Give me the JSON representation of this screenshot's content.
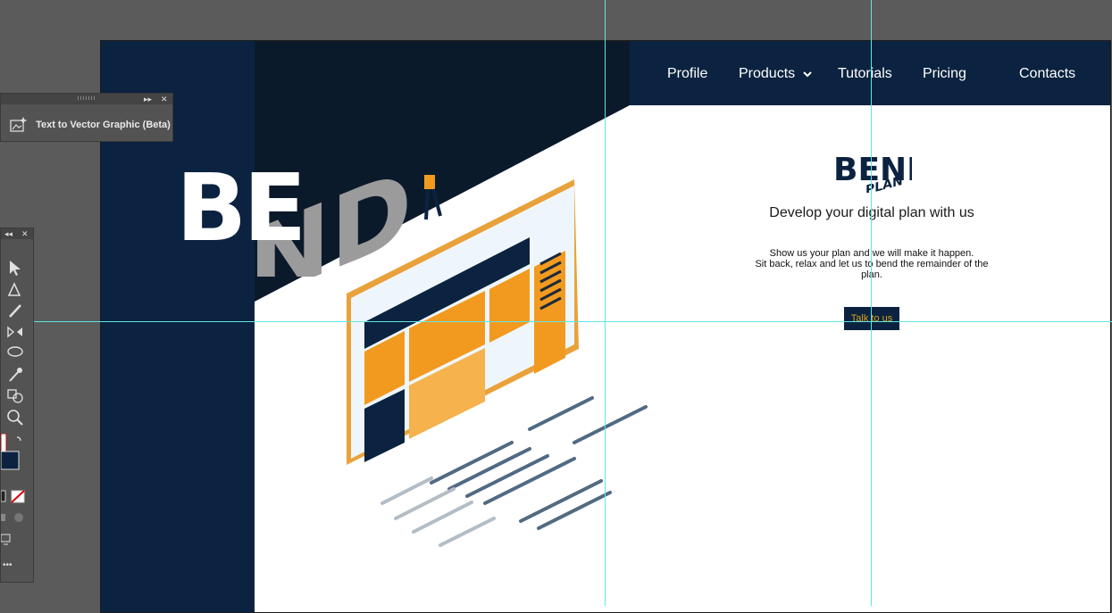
{
  "nav": {
    "items": [
      {
        "label": "Profile"
      },
      {
        "label": "Products",
        "has_dropdown": true
      },
      {
        "label": "Tutorials"
      },
      {
        "label": "Pricing"
      },
      {
        "label": "Contacts"
      }
    ]
  },
  "hero": {
    "logo_text": "BEND",
    "logo_sub": "PLAN",
    "tagline": "Develop your digital plan with us",
    "body_line1": "Show us your plan and we will make it happen.",
    "body_line2": "Sit back, relax and let us to bend the remainder of the plan.",
    "cta_label": "Talk to us"
  },
  "panel": {
    "title": "Text to Vector Graphic (Beta)",
    "icon": "sparkle-image-icon"
  },
  "toolbar": {
    "tools": [
      "selection-tool-icon",
      "pen-tool-icon",
      "paintbrush-tool-icon",
      "reflect-tool-icon",
      "lasso-tool-icon",
      "eyedropper-tool-icon",
      "shape-builder-tool-icon",
      "zoom-tool-icon"
    ]
  },
  "colors": {
    "navy": "#0b2340",
    "orange": "#f29a1f",
    "guide": "#5ee6e6",
    "cta_text": "#d8a21c"
  }
}
